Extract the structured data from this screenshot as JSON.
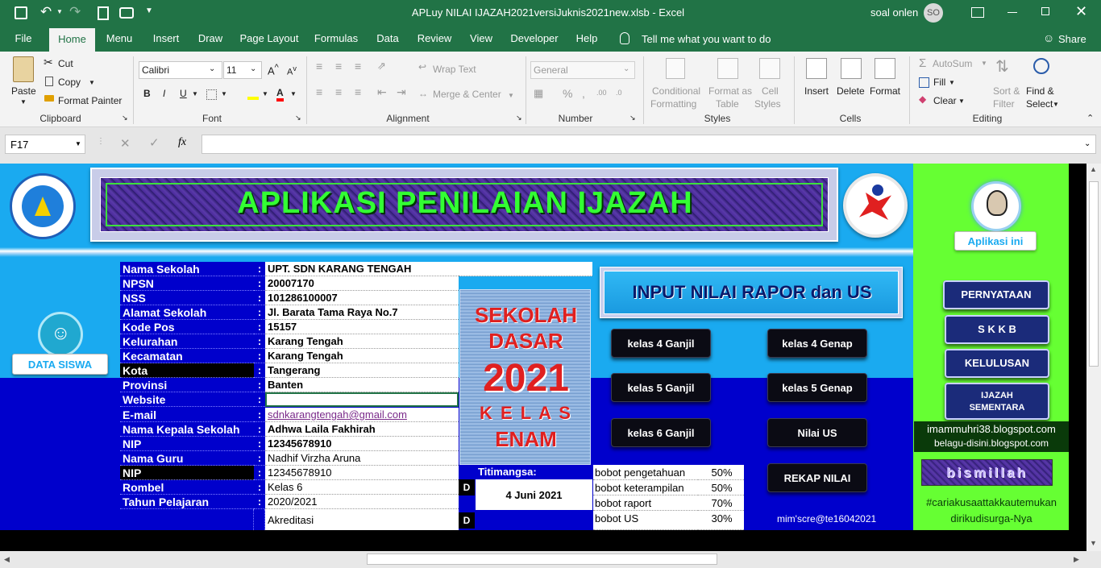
{
  "window": {
    "title": "APLuy NILAI IJAZAH2021versiJuknis2021new.xlsb  -  Excel",
    "user": "soal onlen",
    "user_initials": "SO"
  },
  "menu": [
    "File",
    "Home",
    "Menu",
    "Insert",
    "Draw",
    "Page Layout",
    "Formulas",
    "Data",
    "Review",
    "View",
    "Developer",
    "Help"
  ],
  "tell_me": "Tell me what you want to do",
  "share": "Share",
  "ribbon": {
    "clipboard": {
      "paste": "Paste",
      "cut": "Cut",
      "copy": "Copy",
      "format_painter": "Format Painter",
      "label": "Clipboard"
    },
    "font": {
      "name": "Calibri",
      "size": "11",
      "label": "Font"
    },
    "alignment": {
      "wrap": "Wrap Text",
      "merge": "Merge & Center",
      "label": "Alignment"
    },
    "number": {
      "format": "General",
      "label": "Number"
    },
    "styles": {
      "conditional": "Conditional",
      "formatting": "Formatting",
      "format_as": "Format as",
      "table": "Table",
      "cell": "Cell",
      "cell_styles": "Styles",
      "label": "Styles"
    },
    "cells": {
      "insert": "Insert",
      "delete": "Delete",
      "format": "Format",
      "label": "Cells"
    },
    "editing": {
      "autosum": "AutoSum",
      "fill": "Fill",
      "clear": "Clear",
      "sort": "Sort &",
      "filter": "Filter",
      "find": "Find &",
      "select": "Select",
      "label": "Editing"
    }
  },
  "formula_bar": {
    "name_box": "F17",
    "fx": "fx",
    "content": ""
  },
  "sheet": {
    "banner_title": "APLIKASI PENILAIAN IJAZAH",
    "data_siswa": "DATA SISWA",
    "aplikasi_ini": "Aplikasi ini",
    "fields": [
      {
        "label": "Nama Sekolah",
        "value": "UPT. SDN KARANG TENGAH"
      },
      {
        "label": "NPSN",
        "value": "20007170"
      },
      {
        "label": "NSS",
        "value": "101286100007"
      },
      {
        "label": "Alamat Sekolah",
        "value": "Jl. Barata Tama Raya No.7"
      },
      {
        "label": "Kode Pos",
        "value": "15157"
      },
      {
        "label": "Kelurahan",
        "value": "Karang Tengah"
      },
      {
        "label": "Kecamatan",
        "value": "Karang Tengah"
      },
      {
        "label": "Kota",
        "value": "Tangerang"
      },
      {
        "label": "Provinsi",
        "value": "Banten"
      },
      {
        "label": "Website",
        "value": ""
      },
      {
        "label": "E-mail",
        "value": "sdnkarangtengah@gmail.com"
      },
      {
        "label": "Nama Kepala Sekolah",
        "value": "Adhwa Laila Fakhirah"
      },
      {
        "label": "NIP",
        "value": "12345678910"
      },
      {
        "label": "Nama Guru",
        "value": "Nadhif Virzha Aruna"
      },
      {
        "label": "NIP",
        "value": "12345678910"
      },
      {
        "label": "Rombel",
        "value": "Kelas 6"
      },
      {
        "label": "Tahun Pelajaran",
        "value": "2020/2021"
      }
    ],
    "colon": ":",
    "akreditasi": "Akreditasi",
    "akreditasi_val": "D",
    "d_marker": "D",
    "sd_card": {
      "line1": "SEKOLAH",
      "line2": "DASAR",
      "year": "2021",
      "kelas": "K E L A S",
      "enam": "ENAM"
    },
    "titimangsa_label": "Titimangsa:",
    "titimangsa_date": "4 Juni 2021",
    "input_nilai": "INPUT NILAI RAPOR dan US",
    "grade_buttons": [
      "kelas 4 Ganjil",
      "kelas 4 Genap",
      "kelas 5 Ganjil",
      "kelas 5 Genap",
      "kelas 6 Ganjil",
      "Nilai US",
      "REKAP NILAI"
    ],
    "bobot": [
      {
        "label": "bobot pengetahuan",
        "value": "50%"
      },
      {
        "label": "bobot keterampilan",
        "value": "50%"
      },
      {
        "label": "bobot raport",
        "value": "70%"
      },
      {
        "label": "bobot US",
        "value": "30%"
      }
    ],
    "credit": "mim'scre@te16042021",
    "side_buttons": [
      "PERNYATAAN",
      "S K K B",
      "KELULUSAN",
      "IJAZAH",
      "SEMENTARA"
    ],
    "blog1": "imammuhri38.blogspot.com",
    "blog2": "belagu-disini.blogspot.com",
    "bismillah": "bismillah",
    "hashtag1": "#cariakusaattakkautemukan",
    "hashtag2": "dirikudisurga-Nya"
  }
}
